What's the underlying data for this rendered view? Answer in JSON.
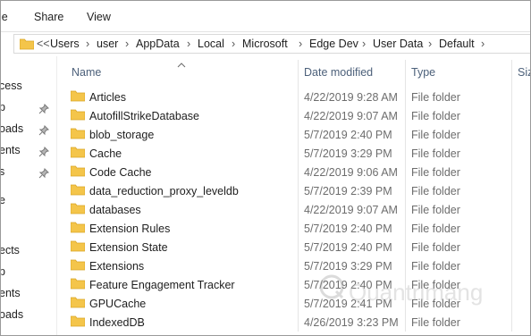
{
  "ribbon": {
    "tabs": [
      "le",
      "Share",
      "View"
    ]
  },
  "address": {
    "chevron": "<<",
    "segments": [
      "Users",
      "user",
      "AppData",
      "Local",
      "Microsoft",
      "Edge Dev",
      "User Data",
      "Default"
    ]
  },
  "nav": {
    "items": [
      "cess",
      "p",
      "oads",
      "ents",
      "s",
      "e",
      "ects",
      "p",
      "ents",
      "oads"
    ]
  },
  "columns": {
    "name": "Name",
    "date": "Date modified",
    "type": "Type",
    "size": "Siz"
  },
  "rows": [
    {
      "name": "Articles",
      "date": "4/22/2019 9:28 AM",
      "type": "File folder"
    },
    {
      "name": "AutofillStrikeDatabase",
      "date": "4/22/2019 9:07 AM",
      "type": "File folder"
    },
    {
      "name": "blob_storage",
      "date": "5/7/2019 2:40 PM",
      "type": "File folder"
    },
    {
      "name": "Cache",
      "date": "5/7/2019 3:29 PM",
      "type": "File folder"
    },
    {
      "name": "Code Cache",
      "date": "4/22/2019 9:06 AM",
      "type": "File folder"
    },
    {
      "name": "data_reduction_proxy_leveldb",
      "date": "5/7/2019 2:39 PM",
      "type": "File folder"
    },
    {
      "name": "databases",
      "date": "4/22/2019 9:07 AM",
      "type": "File folder"
    },
    {
      "name": "Extension Rules",
      "date": "5/7/2019 2:40 PM",
      "type": "File folder"
    },
    {
      "name": "Extension State",
      "date": "5/7/2019 2:40 PM",
      "type": "File folder"
    },
    {
      "name": "Extensions",
      "date": "5/7/2019 3:29 PM",
      "type": "File folder"
    },
    {
      "name": "Feature Engagement Tracker",
      "date": "5/7/2019 2:40 PM",
      "type": "File folder"
    },
    {
      "name": "GPUCache",
      "date": "5/7/2019 2:41 PM",
      "type": "File folder"
    },
    {
      "name": "IndexedDB",
      "date": "4/26/2019 3:23 PM",
      "type": "File folder"
    }
  ],
  "watermark": {
    "text": "Quantrimang"
  },
  "colors": {
    "folder": "#f4c54a",
    "folder_dark": "#d9a524",
    "header_text": "#4c607a"
  }
}
